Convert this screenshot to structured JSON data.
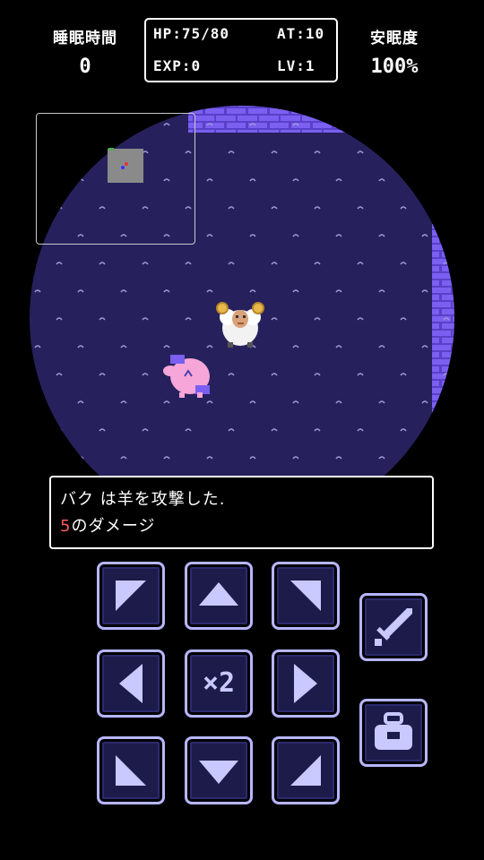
{
  "hud": {
    "sleep_time_label": "睡眠時間",
    "sleep_time_value": "0",
    "hp": "HP:75/80",
    "at": "AT:10",
    "exp": "EXP:0",
    "lv": "LV:1",
    "comfort_label": "安眠度",
    "comfort_value": "100%"
  },
  "message": {
    "line1": "バク は羊を攻撃した.",
    "damage_number": "5",
    "damage_suffix": "のダメージ"
  },
  "controls": {
    "up_left": "arrow-up-left-icon",
    "up": "arrow-up-icon",
    "up_right": "arrow-up-right-icon",
    "left": "arrow-left-icon",
    "speed_label": "×2",
    "right": "arrow-right-icon",
    "down_left": "arrow-down-left-icon",
    "down": "arrow-down-icon",
    "down_right": "arrow-down-right-icon",
    "attack": "sword-icon",
    "item": "bag-icon"
  },
  "colors": {
    "floor": "#26215c",
    "wall": "#6b4fd8",
    "button_border": "#b7b6ff",
    "damage": "#ff5a5a"
  }
}
